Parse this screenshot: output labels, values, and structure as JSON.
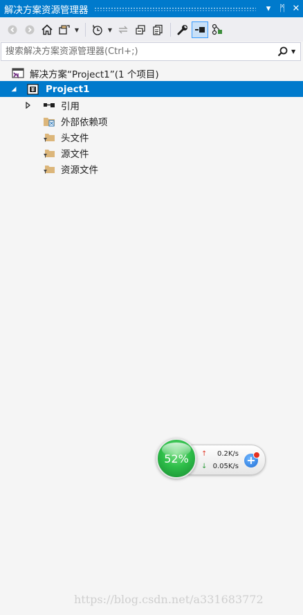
{
  "window": {
    "title": "解决方案资源管理器",
    "buttons": {
      "dropdown": "▾",
      "pin": "ᛗ",
      "close": "✕"
    }
  },
  "toolbar": {
    "items": [
      "back-icon",
      "forward-icon",
      "home-icon",
      "switch-views-icon",
      "pending-changes-filter-icon",
      "sync-icon",
      "collapse-all-icon",
      "show-all-files-icon",
      "properties-icon",
      "preview-selected-icon",
      "class-view-icon"
    ]
  },
  "search": {
    "placeholder": "搜索解决方案资源管理器(Ctrl+;)"
  },
  "tree": {
    "solution": "解决方案“Project1”(1 个项目)",
    "project": "Project1",
    "nodes": {
      "references": "引用",
      "external": "外部依赖项",
      "headers": "头文件",
      "sources": "源文件",
      "resources": "资源文件"
    }
  },
  "net_speed": {
    "percent": "52%",
    "percent_value": 52,
    "upload": "0.2K/s",
    "download": "0.05K/s",
    "up_arrow": "↑",
    "down_arrow": "↓",
    "plus": "+"
  },
  "watermark": "https://blog.csdn.net/a331683772",
  "colors": {
    "accent": "#007acc",
    "background": "#f5f5f5",
    "toolbar": "#eeeef2",
    "folder": "#dcb67a",
    "vs_purple": "#68217a"
  }
}
